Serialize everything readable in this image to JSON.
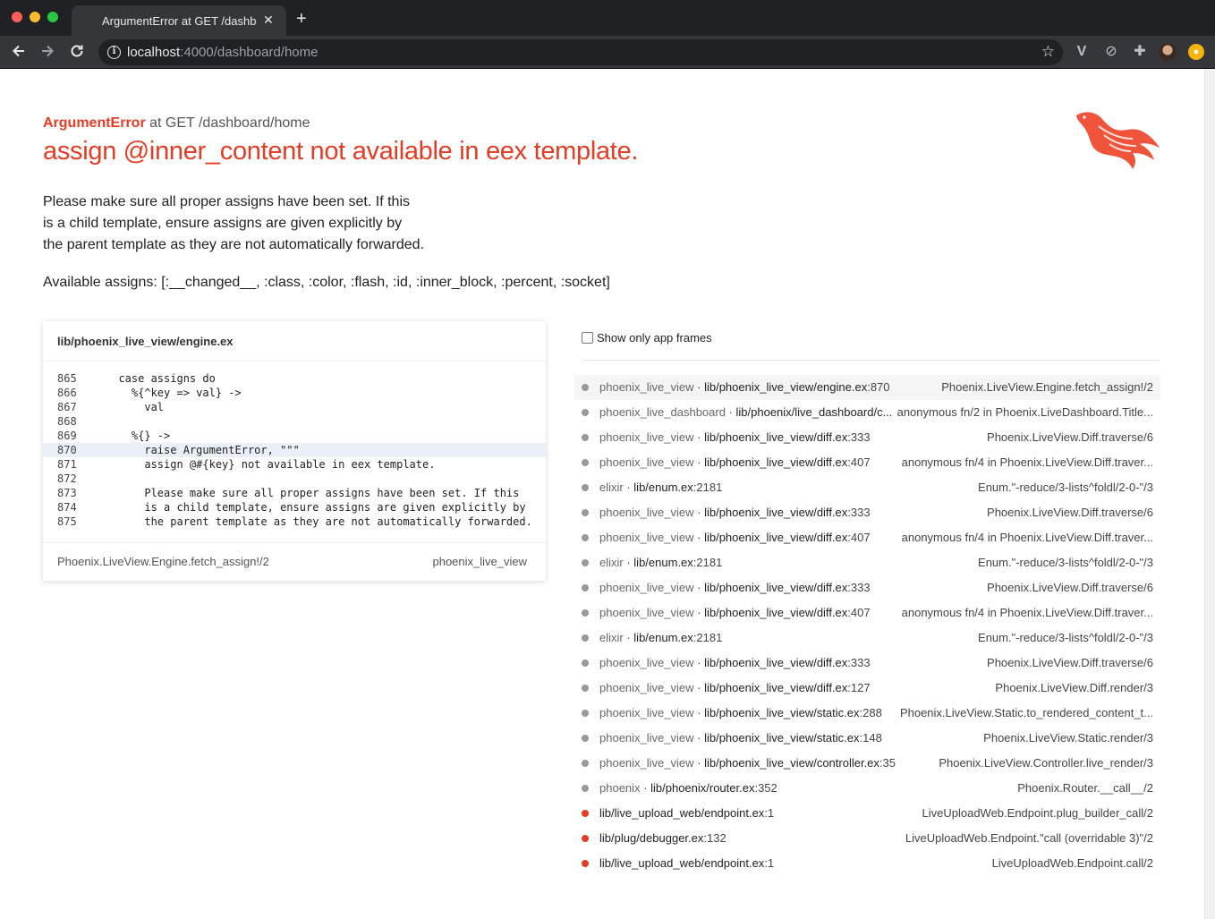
{
  "browser": {
    "tab_title": "ArgumentError at GET /dashboard/home",
    "url_host": "localhost",
    "url_path": ":4000/dashboard/home"
  },
  "error": {
    "class": "ArgumentError",
    "request": "at GET /dashboard/home",
    "message": "assign @inner_content not available in eex template.",
    "description_lines": [
      "Please make sure all proper assigns have been set. If this",
      "is a child template, ensure assigns are given explicitly by",
      "the parent template as they are not automatically forwarded."
    ],
    "available_assigns": "Available assigns: [:__changed__, :class, :color, :flash, :id, :inner_block, :percent, :socket]"
  },
  "code_card": {
    "file": "lib/phoenix_live_view/engine.ex",
    "highlight_line": "870",
    "lines": [
      {
        "num": "865",
        "code": "  case assigns do"
      },
      {
        "num": "866",
        "code": "    %{^key => val} ->"
      },
      {
        "num": "867",
        "code": "      val"
      },
      {
        "num": "868",
        "code": ""
      },
      {
        "num": "869",
        "code": "    %{} ->"
      },
      {
        "num": "870",
        "code": "      raise ArgumentError, \"\"\""
      },
      {
        "num": "871",
        "code": "      assign @#{key} not available in eex template."
      },
      {
        "num": "872",
        "code": ""
      },
      {
        "num": "873",
        "code": "      Please make sure all proper assigns have been set. If this"
      },
      {
        "num": "874",
        "code": "      is a child template, ensure assigns are given explicitly by"
      },
      {
        "num": "875",
        "code": "      the parent template as they are not automatically forwarded."
      }
    ],
    "footer_function": "Phoenix.LiveView.Engine.fetch_assign!/2",
    "footer_app": "phoenix_live_view"
  },
  "frames_panel": {
    "toggle_label": "Show only app frames",
    "frames": [
      {
        "app": "phoenix_live_view",
        "file": "lib/phoenix_live_view/engine.ex",
        "line": ":870",
        "fn": "Phoenix.LiveView.Engine.fetch_assign!/2",
        "kind": "dep",
        "active": true
      },
      {
        "app": "phoenix_live_dashboard",
        "file": "lib/phoenix/live_dashboard/c...",
        "line": "",
        "fn": "anonymous fn/2 in Phoenix.LiveDashboard.Title...",
        "kind": "dep",
        "active": false
      },
      {
        "app": "phoenix_live_view",
        "file": "lib/phoenix_live_view/diff.ex",
        "line": ":333",
        "fn": "Phoenix.LiveView.Diff.traverse/6",
        "kind": "dep",
        "active": false
      },
      {
        "app": "phoenix_live_view",
        "file": "lib/phoenix_live_view/diff.ex",
        "line": ":407",
        "fn": "anonymous fn/4 in Phoenix.LiveView.Diff.traver...",
        "kind": "dep",
        "active": false
      },
      {
        "app": "elixir",
        "file": "lib/enum.ex",
        "line": ":2181",
        "fn": "Enum.\"-reduce/3-lists^foldl/2-0-\"/3",
        "kind": "dep",
        "active": false
      },
      {
        "app": "phoenix_live_view",
        "file": "lib/phoenix_live_view/diff.ex",
        "line": ":333",
        "fn": "Phoenix.LiveView.Diff.traverse/6",
        "kind": "dep",
        "active": false
      },
      {
        "app": "phoenix_live_view",
        "file": "lib/phoenix_live_view/diff.ex",
        "line": ":407",
        "fn": "anonymous fn/4 in Phoenix.LiveView.Diff.traver...",
        "kind": "dep",
        "active": false
      },
      {
        "app": "elixir",
        "file": "lib/enum.ex",
        "line": ":2181",
        "fn": "Enum.\"-reduce/3-lists^foldl/2-0-\"/3",
        "kind": "dep",
        "active": false
      },
      {
        "app": "phoenix_live_view",
        "file": "lib/phoenix_live_view/diff.ex",
        "line": ":333",
        "fn": "Phoenix.LiveView.Diff.traverse/6",
        "kind": "dep",
        "active": false
      },
      {
        "app": "phoenix_live_view",
        "file": "lib/phoenix_live_view/diff.ex",
        "line": ":407",
        "fn": "anonymous fn/4 in Phoenix.LiveView.Diff.traver...",
        "kind": "dep",
        "active": false
      },
      {
        "app": "elixir",
        "file": "lib/enum.ex",
        "line": ":2181",
        "fn": "Enum.\"-reduce/3-lists^foldl/2-0-\"/3",
        "kind": "dep",
        "active": false
      },
      {
        "app": "phoenix_live_view",
        "file": "lib/phoenix_live_view/diff.ex",
        "line": ":333",
        "fn": "Phoenix.LiveView.Diff.traverse/6",
        "kind": "dep",
        "active": false
      },
      {
        "app": "phoenix_live_view",
        "file": "lib/phoenix_live_view/diff.ex",
        "line": ":127",
        "fn": "Phoenix.LiveView.Diff.render/3",
        "kind": "dep",
        "active": false
      },
      {
        "app": "phoenix_live_view",
        "file": "lib/phoenix_live_view/static.ex",
        "line": ":288",
        "fn": "Phoenix.LiveView.Static.to_rendered_content_t...",
        "kind": "dep",
        "active": false
      },
      {
        "app": "phoenix_live_view",
        "file": "lib/phoenix_live_view/static.ex",
        "line": ":148",
        "fn": "Phoenix.LiveView.Static.render/3",
        "kind": "dep",
        "active": false
      },
      {
        "app": "phoenix_live_view",
        "file": "lib/phoenix_live_view/controller.ex",
        "line": ":35",
        "fn": "Phoenix.LiveView.Controller.live_render/3",
        "kind": "dep",
        "active": false
      },
      {
        "app": "phoenix",
        "file": "lib/phoenix/router.ex",
        "line": ":352",
        "fn": "Phoenix.Router.__call__/2",
        "kind": "dep",
        "active": false
      },
      {
        "app": "",
        "file": "lib/live_upload_web/endpoint.ex",
        "line": ":1",
        "fn": "LiveUploadWeb.Endpoint.plug_builder_call/2",
        "kind": "app",
        "active": false
      },
      {
        "app": "",
        "file": "lib/plug/debugger.ex",
        "line": ":132",
        "fn": "LiveUploadWeb.Endpoint.\"call (overridable 3)\"/2",
        "kind": "app",
        "active": false
      },
      {
        "app": "",
        "file": "lib/live_upload_web/endpoint.ex",
        "line": ":1",
        "fn": "LiveUploadWeb.Endpoint.call/2",
        "kind": "app",
        "active": false
      }
    ]
  },
  "colors": {
    "accent": "#e33d25",
    "chrome_dark": "#202124",
    "chrome_toolbar": "#35363a"
  },
  "icons": {
    "back": "arrow-left-icon",
    "forward": "arrow-right-icon",
    "reload": "reload-icon",
    "site_info": "info-icon",
    "bookmark": "star-icon",
    "phoenix_logo": "phoenix-bird-logo"
  }
}
